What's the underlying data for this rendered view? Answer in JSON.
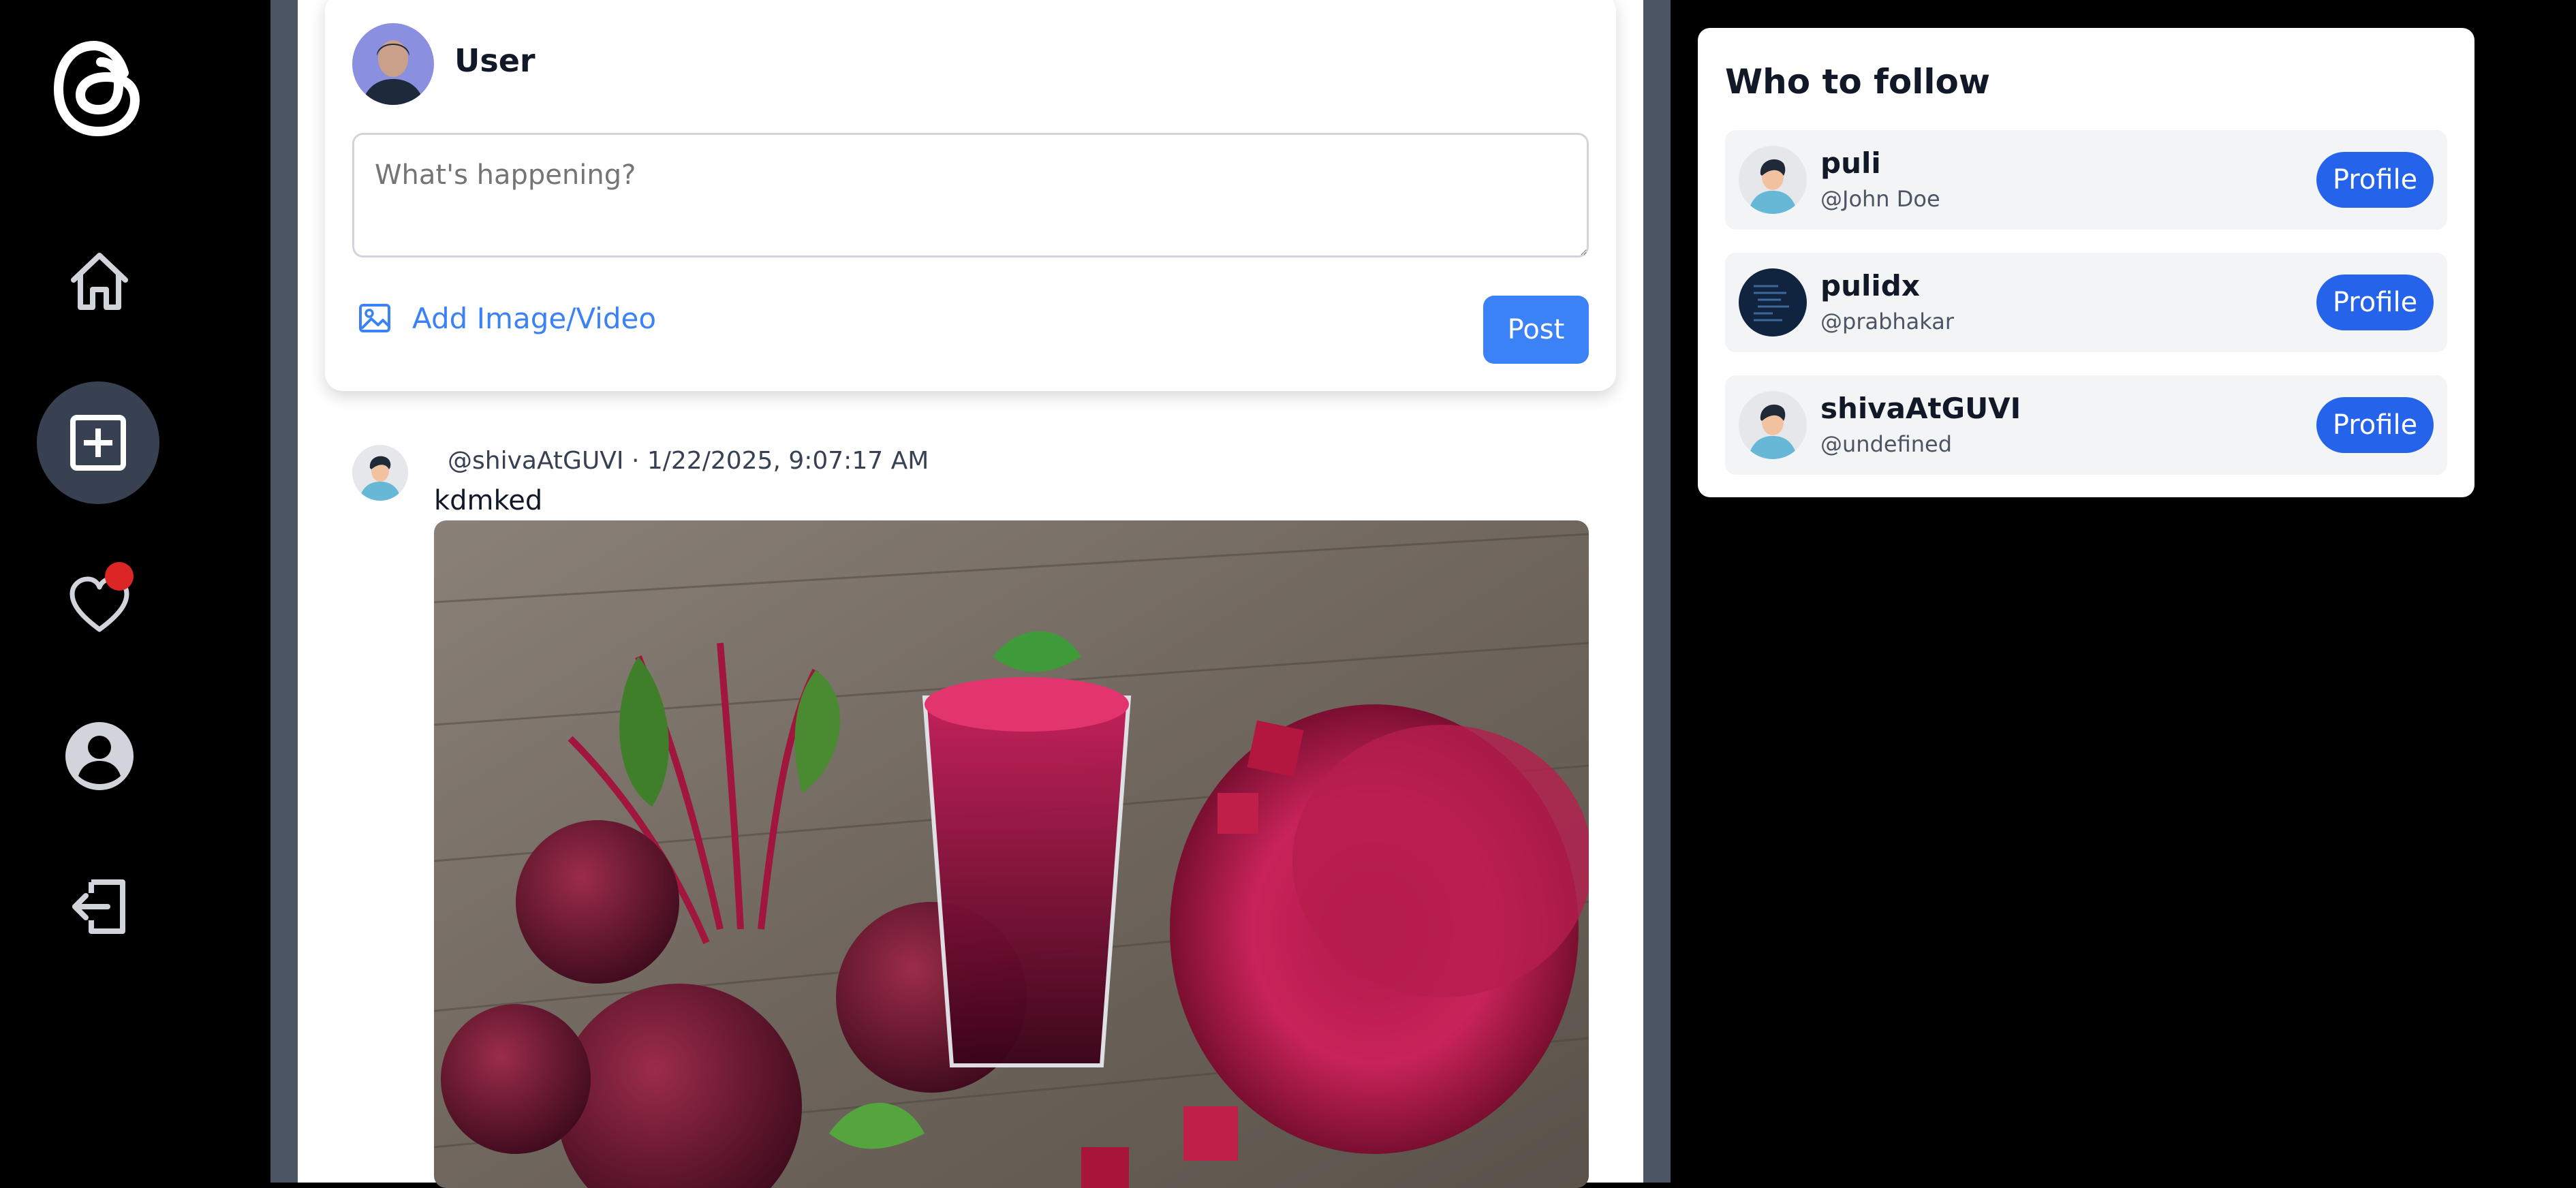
{
  "nav": {
    "logo_icon": "threads-logo-icon",
    "items": [
      {
        "icon": "home-icon"
      },
      {
        "icon": "create-post-icon"
      },
      {
        "icon": "heart-icon",
        "has_notification": true
      },
      {
        "icon": "profile-icon"
      },
      {
        "icon": "logout-icon"
      }
    ],
    "active_color": "#374151",
    "notification_color": "#dc2626"
  },
  "composer": {
    "username": "User",
    "placeholder": "What's happening?",
    "add_media_label": "Add Image/Video",
    "post_label": "Post"
  },
  "post": {
    "meta": "@shivaAtGUVI · 1/22/2025, 9:07:17 AM",
    "text": "kdmked",
    "image_description_icon": "beetroot-juice-photo"
  },
  "who_to_follow": {
    "title": "Who to follow",
    "button_label": "Profile",
    "users": [
      {
        "name": "puli",
        "handle": "@John Doe"
      },
      {
        "name": "pulidx",
        "handle": "@prabhakar"
      },
      {
        "name": "shivaAtGUVI",
        "handle": "@undefined"
      }
    ]
  },
  "colors": {
    "accent": "#3b82f6",
    "profile_button": "#2563eb",
    "feed_border": "#4b5563"
  }
}
